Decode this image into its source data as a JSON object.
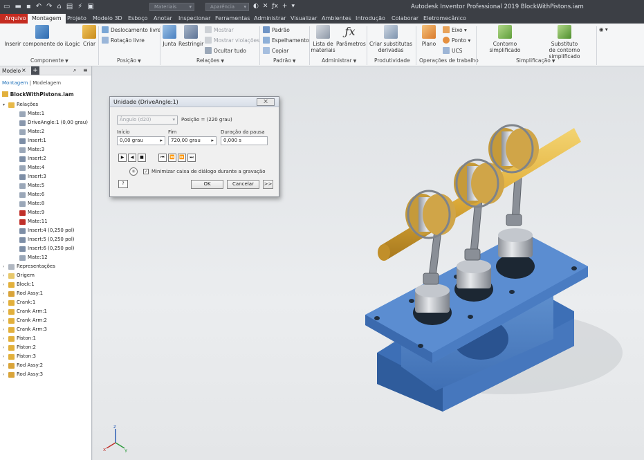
{
  "app": {
    "window_title": "Autodesk Inventor Professional 2019   BlockWithPistons.iam",
    "qat_select_1": "Materiais",
    "qat_select_2": "Aparência"
  },
  "tabs": [
    "Arquivo",
    "Montagem",
    "Projeto",
    "Modelo 3D",
    "Esboço",
    "Anotar",
    "Inspecionar",
    "Ferramentas",
    "Administrar",
    "Visualizar",
    "Ambientes",
    "Introdução",
    "Colaborar",
    "Eletromecânico"
  ],
  "ribbon": {
    "componente": {
      "label": "Componente",
      "inserir": "Inserir componente do iLogic",
      "criar": "Criar"
    },
    "posicao": {
      "label": "Posição",
      "deslocamento": "Deslocamento livre",
      "rotacao": "Rotação livre"
    },
    "relacoes": {
      "label": "Relações",
      "junta": "Junta",
      "restringir": "Restringir",
      "mostrar": "Mostrar",
      "mostrar_violacoes": "Mostrar violações",
      "ocultar": "Ocultar tudo"
    },
    "padrao": {
      "label": "Padrão",
      "padrao": "Padrão",
      "espelhamento": "Espelhamento",
      "copiar": "Copiar"
    },
    "administrar": {
      "label": "Administrar",
      "lista_1": "Lista de",
      "lista_2": "materiais",
      "parametros": "Parâmetros"
    },
    "produtividade": {
      "label": "Produtividade",
      "criar_1": "Criar substitutas",
      "criar_2": "derivadas"
    },
    "operacoes": {
      "label": "Operações de trabalho",
      "plano": "Plano",
      "eixo": "Eixo",
      "ponto": "Ponto",
      "ucs": "UCS"
    },
    "simplificacao": {
      "label": "Simplificação",
      "contorno": "Contorno simplificado",
      "substituto_1": "Substituto",
      "substituto_2": "de contorno simplificado"
    }
  },
  "browser": {
    "title": "Modelo",
    "close": "×",
    "add": "+",
    "mode_1": "Montagem",
    "mode_2": "Modelagem",
    "root": "BlockWithPistons.iam",
    "nodes": [
      {
        "label": "Relações",
        "level": 0,
        "exp": "▾",
        "icon": "folder-open"
      },
      {
        "label": "Mate:1",
        "level": 1,
        "icon": "mate"
      },
      {
        "label": "DriveAngle:1 (0,00 grau)",
        "level": 1,
        "icon": "angle"
      },
      {
        "label": "Mate:2",
        "level": 1,
        "icon": "mate"
      },
      {
        "label": "Insert:1",
        "level": 1,
        "icon": "insert"
      },
      {
        "label": "Mate:3",
        "level": 1,
        "icon": "mate"
      },
      {
        "label": "Insert:2",
        "level": 1,
        "icon": "insert"
      },
      {
        "label": "Mate:4",
        "level": 1,
        "icon": "mate"
      },
      {
        "label": "Insert:3",
        "level": 1,
        "icon": "insert"
      },
      {
        "label": "Mate:5",
        "level": 1,
        "icon": "mate"
      },
      {
        "label": "Mate:6",
        "level": 1,
        "icon": "mate"
      },
      {
        "label": "Mate:8",
        "level": 1,
        "icon": "mate"
      },
      {
        "label": "Mate:9",
        "level": 1,
        "icon": "mate-red"
      },
      {
        "label": "Mate:11",
        "level": 1,
        "icon": "mate-red"
      },
      {
        "label": "Insert:4 (0,250 pol)",
        "level": 1,
        "icon": "insert"
      },
      {
        "label": "Insert:5 (0,250 pol)",
        "level": 1,
        "icon": "insert"
      },
      {
        "label": "Insert:6 (0,250 pol)",
        "level": 1,
        "icon": "insert"
      },
      {
        "label": "Mate:12",
        "level": 1,
        "icon": "mate"
      },
      {
        "label": "Representações",
        "level": 0,
        "exp": "›",
        "icon": "reps"
      },
      {
        "label": "Origem",
        "level": 0,
        "exp": "›",
        "icon": "folder"
      },
      {
        "label": "Block:1",
        "level": 0,
        "exp": "›",
        "icon": "part"
      },
      {
        "label": "Rod Assy:1",
        "level": 0,
        "exp": "›",
        "icon": "assy"
      },
      {
        "label": "Crank:1",
        "level": 0,
        "exp": "›",
        "icon": "part"
      },
      {
        "label": "Crank Arm:1",
        "level": 0,
        "exp": "›",
        "icon": "part"
      },
      {
        "label": "Crank Arm:2",
        "level": 0,
        "exp": "›",
        "icon": "part"
      },
      {
        "label": "Crank Arm:3",
        "level": 0,
        "exp": "›",
        "icon": "part"
      },
      {
        "label": "Piston:1",
        "level": 0,
        "exp": "›",
        "icon": "part"
      },
      {
        "label": "Piston:2",
        "level": 0,
        "exp": "›",
        "icon": "part"
      },
      {
        "label": "Piston:3",
        "level": 0,
        "exp": "›",
        "icon": "part"
      },
      {
        "label": "Rod Assy:2",
        "level": 0,
        "exp": "›",
        "icon": "assy"
      },
      {
        "label": "Rod Assy:3",
        "level": 0,
        "exp": "›",
        "icon": "assy"
      }
    ]
  },
  "dialog": {
    "title": "Unidade (DriveAngle:1)",
    "close": "⨉",
    "angle_select": "Ângulo (d20)",
    "position": "Posição = (220 grau)",
    "inicio_label": "Início",
    "inicio_value": "0,00 grau",
    "fim_label": "Fim",
    "fim_value": "720,00 grau",
    "pausa_label": "Duração da pausa",
    "pausa_value": "0,000 s",
    "minimize_label": "Minimizar caixa de diálogo durante a gravação",
    "minimize_checked": true,
    "ok": "OK",
    "cancel": "Cancelar",
    "more": ">>"
  },
  "colors": {
    "block": "#4a7fc8",
    "shaft": "#e2b03c",
    "piston": "#b8bcc3",
    "file_tab": "#c52b20"
  }
}
